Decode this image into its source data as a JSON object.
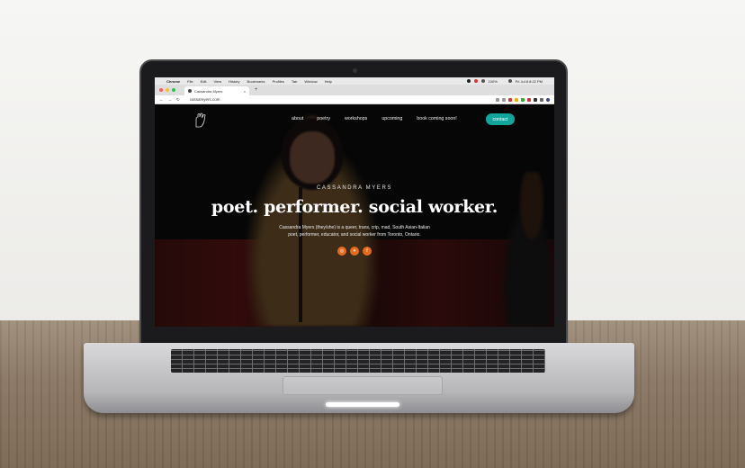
{
  "menubar": {
    "apple": "",
    "items": [
      "Chrome",
      "File",
      "Edit",
      "View",
      "History",
      "Bookmarks",
      "Profiles",
      "Tab",
      "Window",
      "Help"
    ],
    "battery": "100%",
    "clock": "Fri Jul 8  8:22 PM"
  },
  "browser": {
    "tab_title": "Cassandra Myers",
    "tab_close": "×",
    "new_tab": "+",
    "url": "cassamyers.com",
    "back": "←",
    "forward": "→",
    "reload": "↻"
  },
  "site": {
    "nav": [
      "about",
      "poetry",
      "workshops",
      "upcoming",
      "book coming soon!"
    ],
    "contact": "contact",
    "eyebrow": "CASSANDRA MYERS",
    "headline": "poet. performer. social worker.",
    "bio": "Cassandra Myers (they/she) is a queer, trans, crip, mad, South Asian-Italian poet, performer, educator, and social worker from Toronto, Ontario.",
    "socials": [
      {
        "icon": "instagram-icon",
        "glyph": "◎"
      },
      {
        "icon": "twitter-icon",
        "glyph": "✦"
      },
      {
        "icon": "facebook-icon",
        "glyph": "f"
      }
    ]
  },
  "colors": {
    "accent_contact": "#11a59c",
    "social_orange": "#e56a1d"
  }
}
